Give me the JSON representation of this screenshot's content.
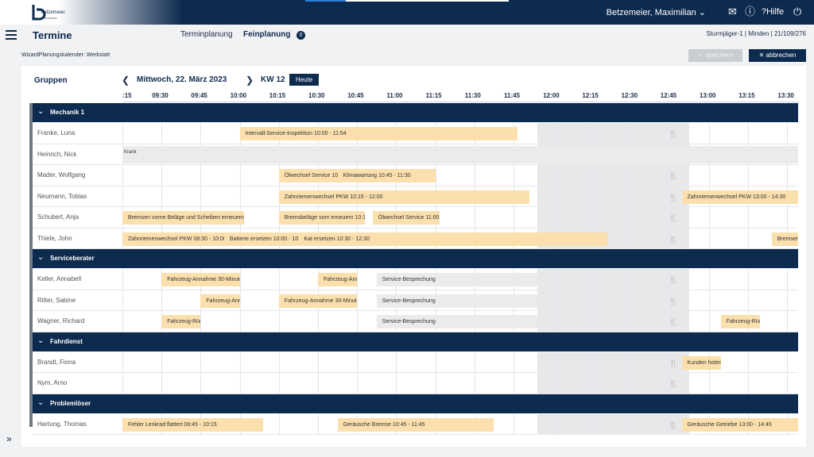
{
  "app": {
    "logo_name": "betzemeier",
    "logo_sub": "automotive"
  },
  "progress": 0.2,
  "user": {
    "name": "Betzemeier, Maximilian"
  },
  "header": {
    "title": "Termine",
    "terminplanung": "Terminplanung",
    "feinplanung": "Feinplanung",
    "badge": "0",
    "context": "Sturmjäger-1 | Minden | 21/109/276"
  },
  "crumb": "WizardPlanungskalender: Werkstatt",
  "buttons": {
    "save": "✓ speichern",
    "cancel": "✕ abbrechen"
  },
  "calendar": {
    "groups_label": "Gruppen",
    "date": "Mittwoch, 22. März 2023",
    "week": "KW 12",
    "today": "Heute"
  },
  "times": [
    ":15",
    "09:30",
    "09:45",
    "10:00",
    "10:15",
    "10:30",
    "10:45",
    "11:00",
    "11:15",
    "11:30",
    "11:45",
    "12:00",
    "12:15",
    "12:30",
    "12:45",
    "13:00",
    "13:15",
    "13:30"
  ],
  "groups": [
    {
      "name": "Mechanik 1",
      "rows": [
        {
          "name": "Franke, Luna",
          "bars": [
            {
              "text": "Intervall-Service-Inspektion 10:00 - 11:54",
              "s": 3,
              "e": 10.1
            }
          ]
        },
        {
          "name": "Heinrich, Nick",
          "bars": [
            {
              "text": "Krank",
              "s": 0,
              "e": 17.6,
              "kind": "grey",
              "note": true
            }
          ]
        },
        {
          "name": "Mader, Wolfgang",
          "bars": [
            {
              "text": "Ölwechsel Service 10:15 - 10:45",
              "s": 4,
              "e": 5.5
            },
            {
              "text": "Klimawartung 10:45 - 11:30",
              "s": 5.5,
              "e": 8
            }
          ]
        },
        {
          "name": "Neumann, Tobias",
          "bars": [
            {
              "text": "Zahnriemenwechsel PKW 10:15 - 12:00",
              "s": 4,
              "e": 10.4
            },
            {
              "text": "Zahnriemenwechsel PKW 13:00 - 14:30",
              "s": 14.3,
              "e": 17.6
            }
          ]
        },
        {
          "name": "Schubert, Anja",
          "bars": [
            {
              "text": "Bremsen vorne Beläge und Scheiben erneuern",
              "s": 0,
              "e": 3.1
            },
            {
              "text": "Bremsbeläge vorn erneuern 10:15 - 10:45",
              "s": 4,
              "e": 6.2
            },
            {
              "text": "Ölwechsel Service 11:00 - 11:30",
              "s": 6.4,
              "e": 8.1
            }
          ]
        },
        {
          "name": "Thiele, John",
          "bars": [
            {
              "text": "Zahnriemenwechsel PKW 08:30 - 10:00",
              "s": 0,
              "e": 2.6
            },
            {
              "text": "Batterie ersetzen 10:00 - 10:30",
              "s": 2.6,
              "e": 4.5
            },
            {
              "text": "Kat ersetzen 10:30 - 12:30",
              "s": 4.5,
              "e": 12.4
            },
            {
              "text": "Bremsen",
              "s": 16.6,
              "e": 17.6
            }
          ]
        }
      ]
    },
    {
      "name": "Serviceberater",
      "rows": [
        {
          "name": "Keller, Annabell",
          "bars": [
            {
              "text": "Fahrzeug-Annahme 30-Minuten",
              "s": 1,
              "e": 3
            },
            {
              "text": "Fahrzeug-Annahme",
              "s": 5,
              "e": 6
            },
            {
              "text": "Service-Besprechung",
              "s": 6.5,
              "e": 10.6,
              "kind": "grey"
            }
          ]
        },
        {
          "name": "Ritter, Sabine",
          "bars": [
            {
              "text": "Fahrzeug-Annahme",
              "s": 2,
              "e": 3
            },
            {
              "text": "Fahrzeug-Annahme 30-Minuten",
              "s": 4,
              "e": 6
            },
            {
              "text": "Service-Besprechung",
              "s": 6.5,
              "e": 10.6,
              "kind": "grey"
            }
          ]
        },
        {
          "name": "Wagner, Richard",
          "bars": [
            {
              "text": "Fahrzeug-Rückgabe",
              "s": 1,
              "e": 2
            },
            {
              "text": "Service-Besprechung",
              "s": 6.5,
              "e": 10.6,
              "kind": "grey"
            },
            {
              "text": "Fahrzeug-Rückgabe",
              "s": 15.3,
              "e": 16.3
            }
          ]
        }
      ]
    },
    {
      "name": "Fahrdienst",
      "rows": [
        {
          "name": "Brandt, Fiona",
          "bars": [
            {
              "text": "Kunden holen",
              "s": 14.3,
              "e": 15.3
            }
          ]
        },
        {
          "name": "Nym, Arno",
          "bars": []
        }
      ]
    },
    {
      "name": "Problemlöser",
      "rows": [
        {
          "name": "Hartung, Thomas",
          "bars": [
            {
              "text": "Fehler Lenkrad flattert 08:45 - 10:15",
              "s": 0,
              "e": 3.6
            },
            {
              "text": "Geräusche Bremse 10:45 - 11:45",
              "s": 5.5,
              "e": 9.5
            },
            {
              "text": "Geräusche Getriebe 13:00 - 14:45",
              "s": 14.3,
              "e": 17.6
            }
          ]
        }
      ]
    }
  ]
}
